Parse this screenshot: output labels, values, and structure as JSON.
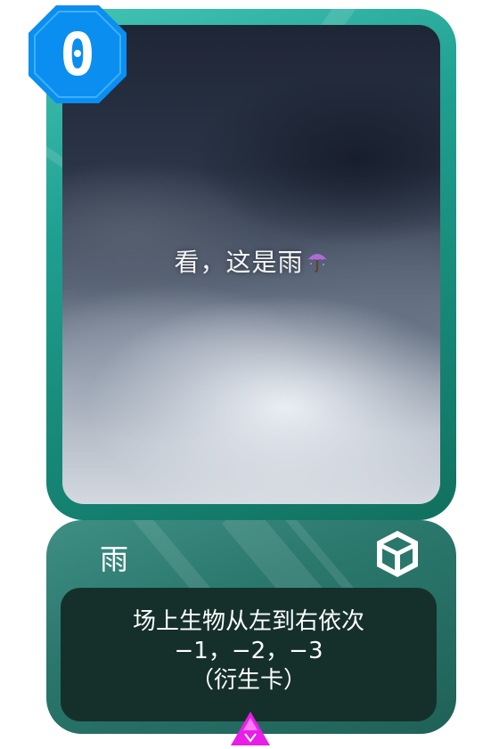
{
  "card": {
    "cost": "0",
    "art_caption": "看，这是雨",
    "art_emoji": "umbrella-with-rain-icon",
    "name": "雨",
    "type_icon": "cube-icon",
    "description": {
      "line1": "场上生物从左到右依次",
      "line2": "−1，−2，−3",
      "line3": "（衍生卡）"
    },
    "rarity_icon": "triangle-gem-icon"
  },
  "colors": {
    "frame": "#1f9f90",
    "panel": "#2a776c",
    "desc_bg": "#15302b",
    "cost_badge": "#0a8ef0",
    "rarity_gem": "#e81ee8"
  }
}
